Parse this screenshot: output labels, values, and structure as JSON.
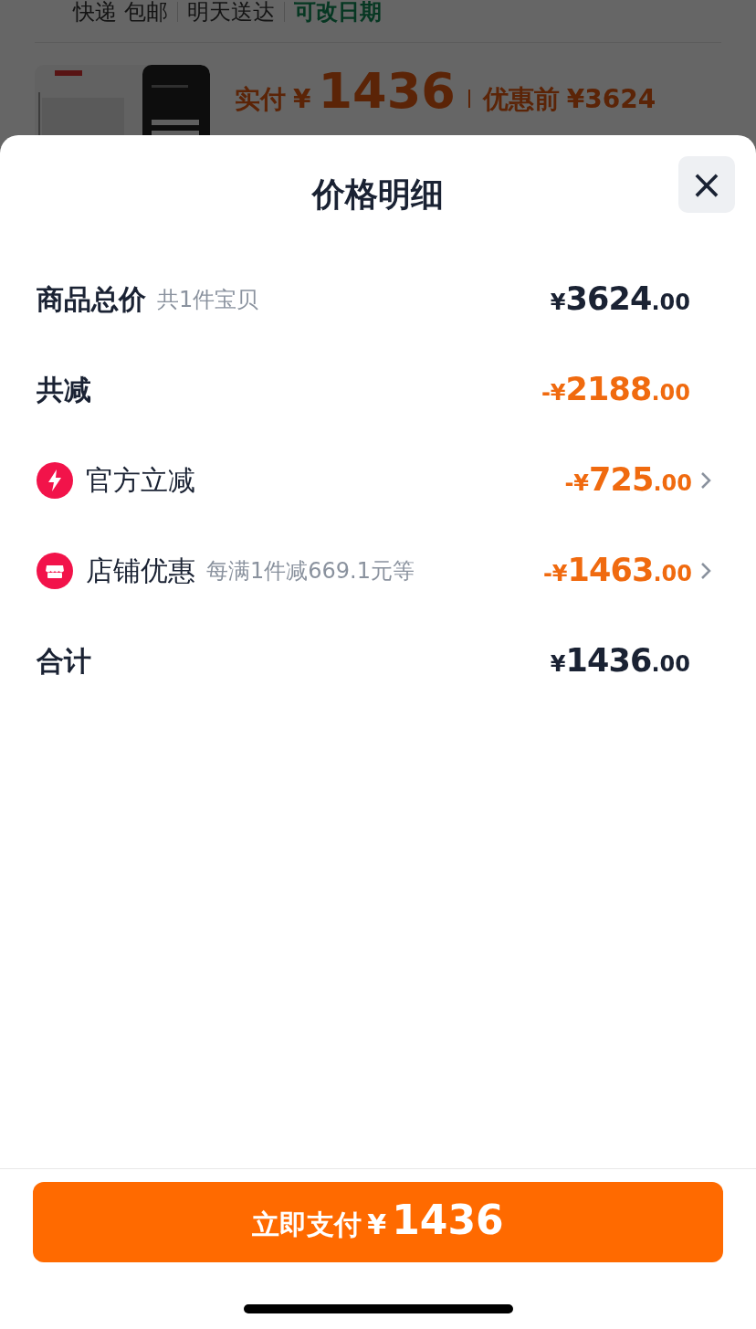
{
  "background_page": {
    "delivery": [
      {
        "text": "快递 包邮",
        "kind": "plain"
      },
      {
        "text": "明天送达",
        "kind": "plain"
      },
      {
        "text": "可改日期",
        "kind": "highlight"
      }
    ],
    "product": {
      "paid_label": "实付",
      "paid_currency": "¥",
      "paid_amount": "1436",
      "before_label": "优惠前",
      "before_price": "¥3624"
    }
  },
  "sheet": {
    "title": "价格明细",
    "close": "×",
    "rows": [
      {
        "kind": "plain",
        "label": "商品总价",
        "note": "共1件宝贝",
        "prefix": "¥",
        "amount": "3624",
        "cents": ".00",
        "discount": false,
        "chevron": false
      },
      {
        "kind": "plain",
        "label": "共减",
        "prefix": "-¥",
        "amount": "2188",
        "cents": ".00",
        "discount": true,
        "chevron": false
      },
      {
        "kind": "lightning",
        "label": "官方立减",
        "prefix": "-¥",
        "amount": "725",
        "cents": ".00",
        "discount": true,
        "chevron": true
      },
      {
        "kind": "shop",
        "label": "店铺优惠",
        "note": "每满1件减669.1元等",
        "prefix": "-¥",
        "amount": "1463",
        "cents": ".00",
        "discount": true,
        "chevron": true
      },
      {
        "kind": "plain",
        "label": "合计",
        "prefix": "¥",
        "amount": "1436",
        "cents": ".00",
        "discount": false,
        "chevron": false
      }
    ]
  },
  "pay_button": {
    "label": "立即支付",
    "currency": "¥",
    "amount": "1436"
  }
}
